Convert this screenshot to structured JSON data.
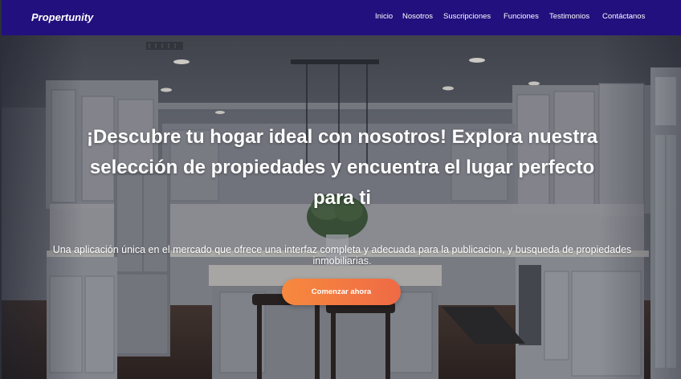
{
  "brand": {
    "name": "Propertunity"
  },
  "nav": {
    "items": [
      {
        "label": "Inicio"
      },
      {
        "label": "Nosotros"
      },
      {
        "label": "Suscripciones"
      },
      {
        "label": "Funciones"
      },
      {
        "label": "Testimonios"
      },
      {
        "label": "Contáctanos"
      }
    ]
  },
  "hero": {
    "title": "¡Descubre tu hogar ideal con nosotros! Explora nuestra selección de propiedades y encuentra el lugar perfecto para ti",
    "description": "Una aplicación única en el mercado que ofrece una interfaz completa y adecuada para la publicacion, y busqueda de propiedades inmobiliarias.",
    "cta_label": "Comenzar ahora",
    "background_image": "kitchen-interior-photo"
  },
  "colors": {
    "navbar": "#21107e",
    "cta_start": "#f7893e",
    "cta_end": "#ef6a45",
    "text": "#ffffff"
  }
}
